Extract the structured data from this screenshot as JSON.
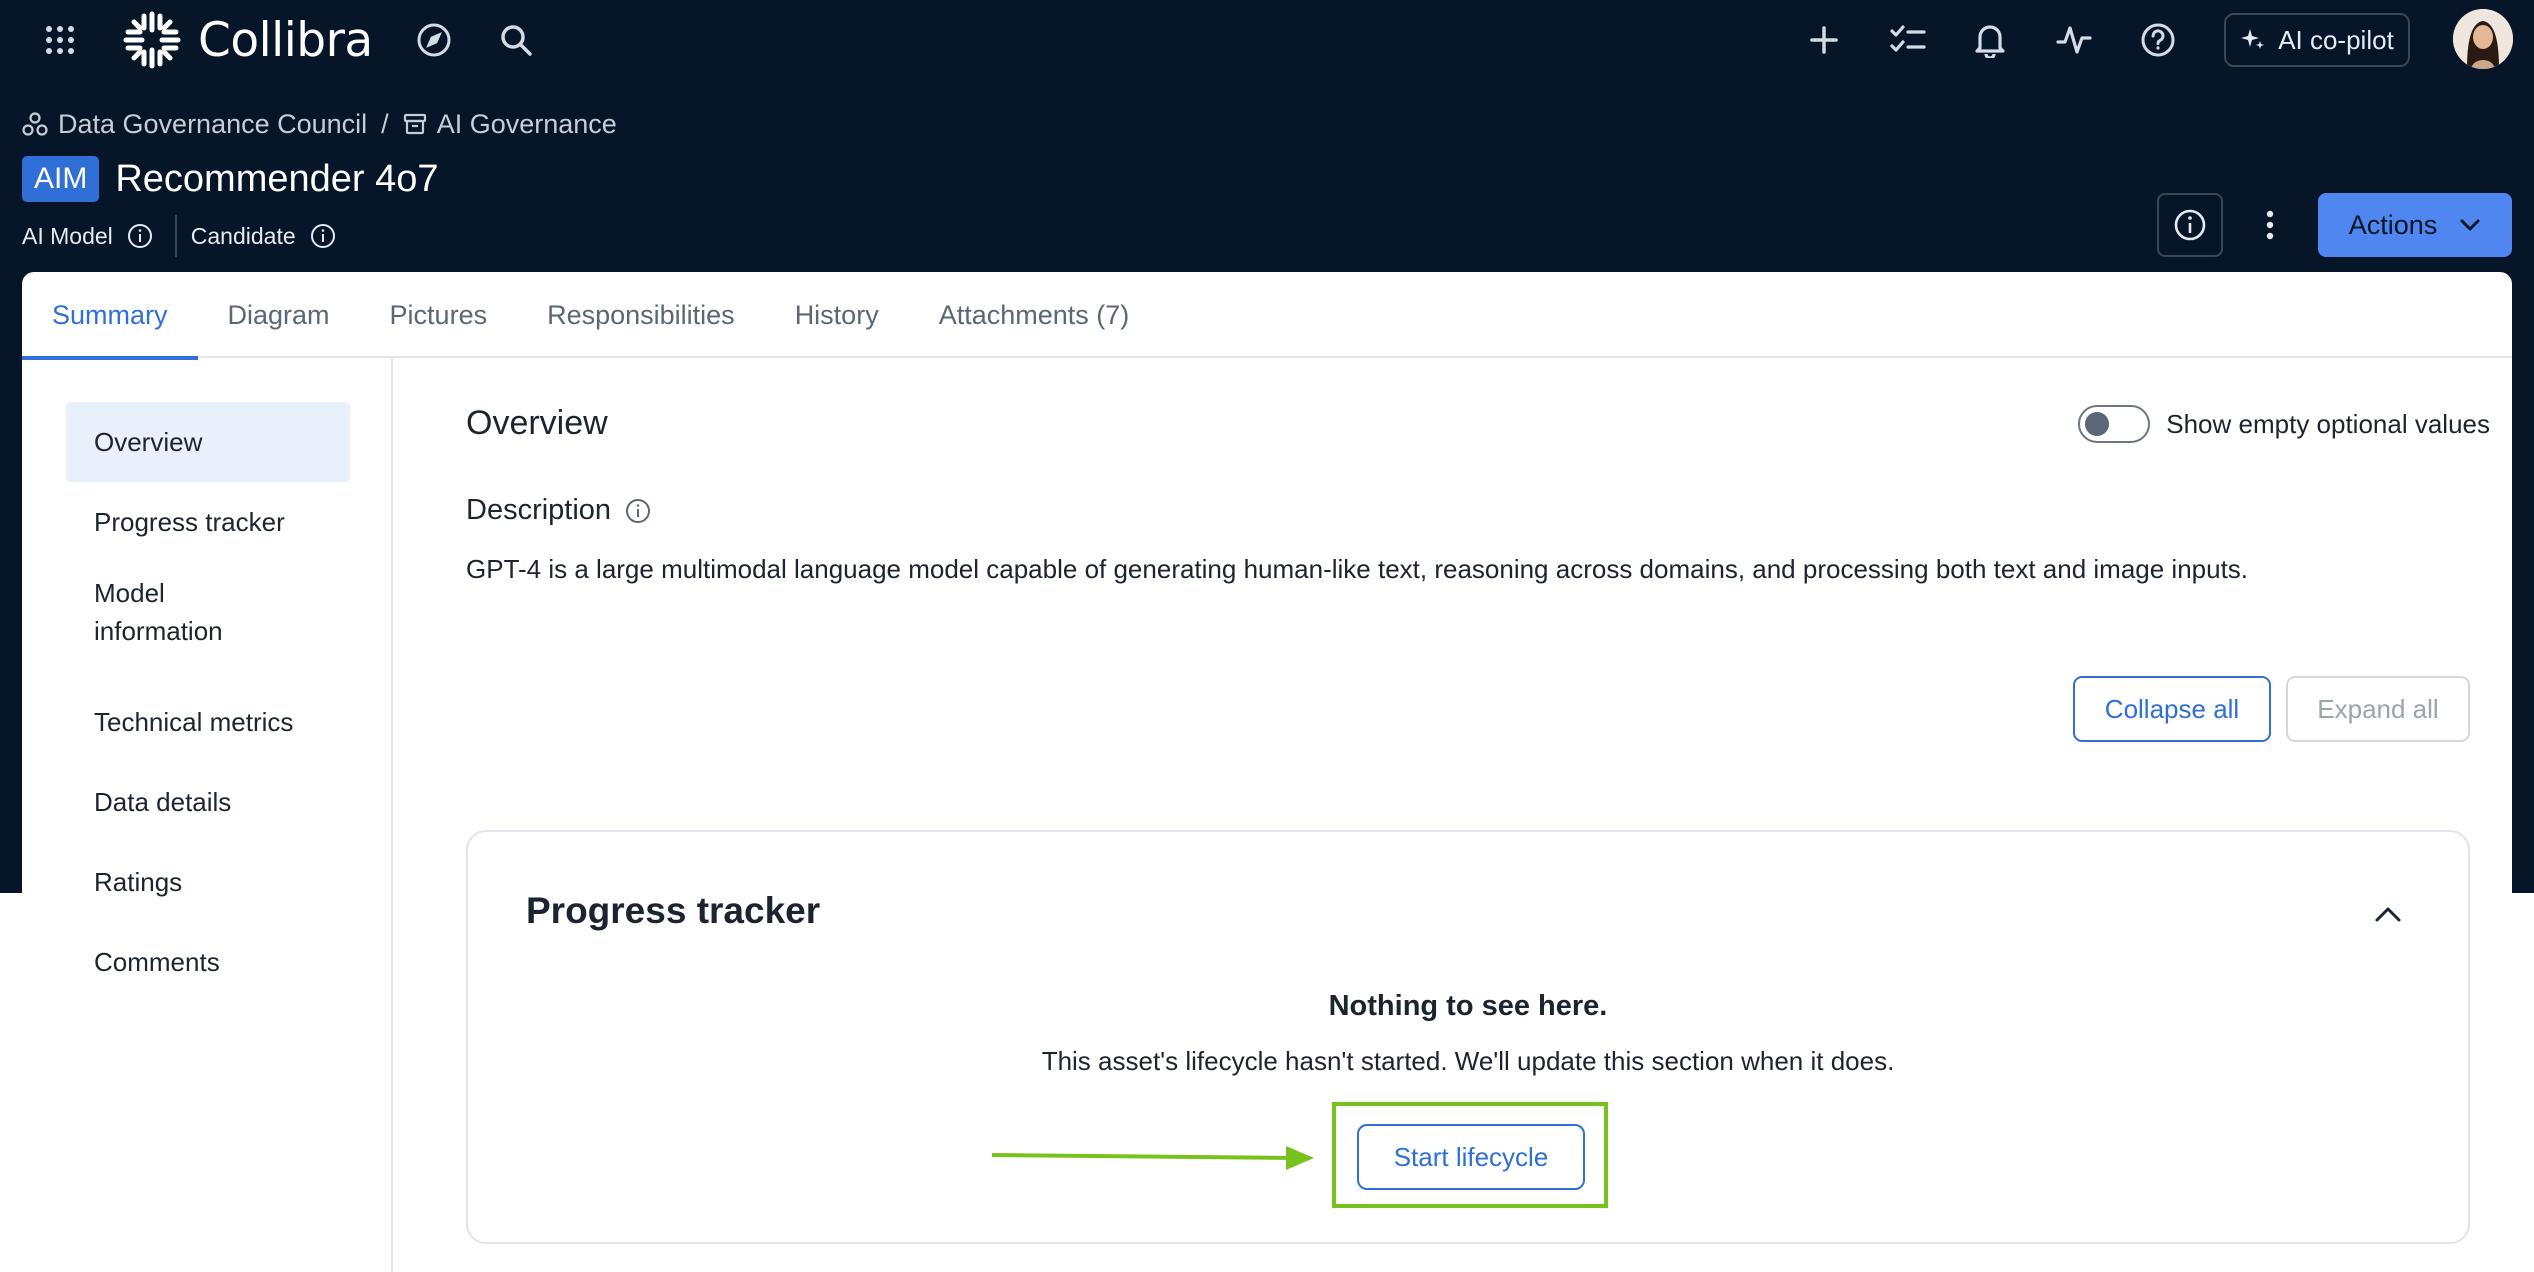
{
  "app": {
    "name": "Collibra",
    "copilot_label": "AI co-pilot"
  },
  "breadcrumb": {
    "community": "Data Governance Council",
    "separator": "/",
    "domain": "AI Governance"
  },
  "asset": {
    "badge": "AIM",
    "title": "Recommender 4o7",
    "type": "AI Model",
    "status": "Candidate"
  },
  "header_actions": {
    "actions_label": "Actions"
  },
  "tabs": [
    {
      "label": "Summary",
      "active": true
    },
    {
      "label": "Diagram",
      "active": false
    },
    {
      "label": "Pictures",
      "active": false
    },
    {
      "label": "Responsibilities",
      "active": false
    },
    {
      "label": "History",
      "active": false
    },
    {
      "label": "Attachments (7)",
      "active": false
    }
  ],
  "sidenav": {
    "items": [
      {
        "label": "Overview",
        "active": true
      },
      {
        "label": "Progress tracker",
        "active": false
      },
      {
        "label": "Model information",
        "active": false
      },
      {
        "label": "Technical metrics",
        "active": false
      },
      {
        "label": "Data details",
        "active": false
      },
      {
        "label": "Ratings",
        "active": false
      },
      {
        "label": "Comments",
        "active": false
      }
    ]
  },
  "overview": {
    "title": "Overview",
    "toggle_label": "Show empty optional values",
    "toggle_on": false,
    "description_label": "Description",
    "description_text": "GPT-4 is a large multimodal language model capable of generating human-like text, reasoning across domains, and processing both text and image inputs.",
    "collapse_all": "Collapse all",
    "expand_all": "Expand all"
  },
  "progress_tracker": {
    "title": "Progress tracker",
    "empty_title": "Nothing to see here.",
    "empty_subtitle": "This asset's lifecycle hasn't started. We'll update this section when it does.",
    "start_button": "Start lifecycle"
  },
  "colors": {
    "header_bg": "#061528",
    "accent": "#2f6fd6",
    "actions_button": "#4f86ef",
    "highlight": "#78c21e"
  }
}
